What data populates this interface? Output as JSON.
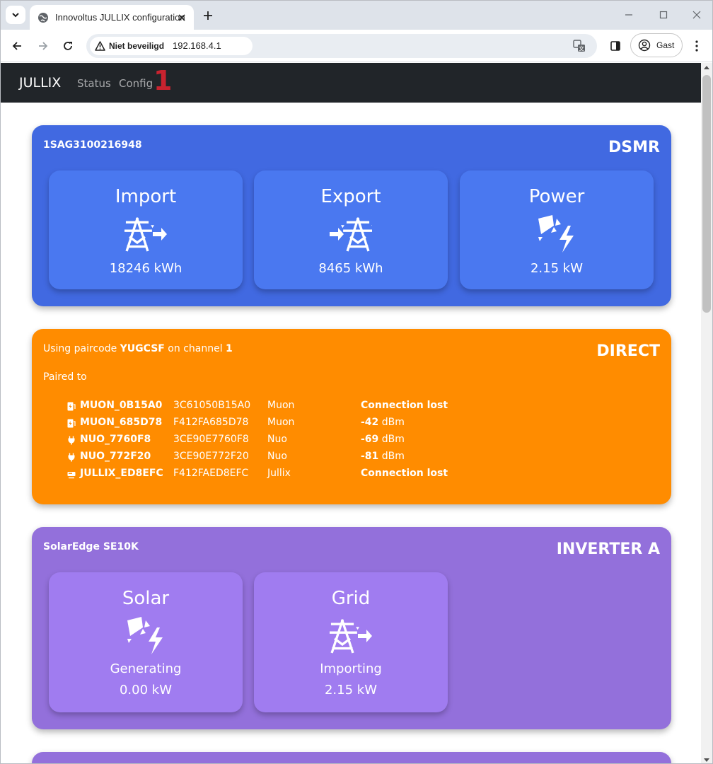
{
  "browser": {
    "tab_title": "Innovoltus JULLIX configuration",
    "security_chip": "Niet beveiligd",
    "url": "192.168.4.1",
    "profile_label": "Gast"
  },
  "nav": {
    "brand": "JULLIX",
    "links": [
      "Status",
      "Config"
    ],
    "badge": "1"
  },
  "dsmr": {
    "serial": "1SAG3100216948",
    "title": "DSMR",
    "tiles": [
      {
        "label": "Import",
        "value": "18246 kWh",
        "icon": "grid-import-icon"
      },
      {
        "label": "Export",
        "value": "8465 kWh",
        "icon": "grid-export-icon"
      },
      {
        "label": "Power",
        "value": "2.15 kW",
        "icon": "solar-power-icon"
      }
    ]
  },
  "direct": {
    "title": "DIRECT",
    "paircode_prefix": "Using paircode ",
    "paircode": "YUGCSF",
    "channel_prefix": " on channel ",
    "channel": "1",
    "paired_to": "Paired to",
    "devices": [
      {
        "icon": "charger-icon",
        "name": "MUON_0B15A0",
        "mac": "3C61050B15A0",
        "type": "Muon",
        "status_bold": "Connection lost",
        "status_unit": ""
      },
      {
        "icon": "charger-icon",
        "name": "MUON_685D78",
        "mac": "F412FA685D78",
        "type": "Muon",
        "status_bold": "-42",
        "status_unit": " dBm"
      },
      {
        "icon": "plug-icon",
        "name": "NUO_7760F8",
        "mac": "3CE90E7760F8",
        "type": "Nuo",
        "status_bold": "-69",
        "status_unit": " dBm"
      },
      {
        "icon": "plug-icon",
        "name": "NUO_772F20",
        "mac": "3CE90E772F20",
        "type": "Nuo",
        "status_bold": "-81",
        "status_unit": " dBm"
      },
      {
        "icon": "jullix-device-icon",
        "name": "JULLIX_ED8EFC",
        "mac": "F412FAED8EFC",
        "type": "Jullix",
        "status_bold": "Connection lost",
        "status_unit": ""
      }
    ]
  },
  "inverter_a": {
    "model": "SolarEdge SE10K",
    "title": "INVERTER A",
    "tiles": [
      {
        "label": "Solar",
        "state": "Generating",
        "value": "0.00 kW",
        "icon": "solar-power-icon"
      },
      {
        "label": "Grid",
        "state": "Importing",
        "value": "2.15 kW",
        "icon": "grid-import-icon"
      }
    ]
  },
  "colors": {
    "navbar": "#212529",
    "dsmr_card": "#4169e1",
    "dsmr_tile": "#4a78f0",
    "direct_card": "#ff8c00",
    "inverter_card": "#9370db",
    "inverter_tile": "#a07cf0",
    "badge": "#c9232f"
  }
}
